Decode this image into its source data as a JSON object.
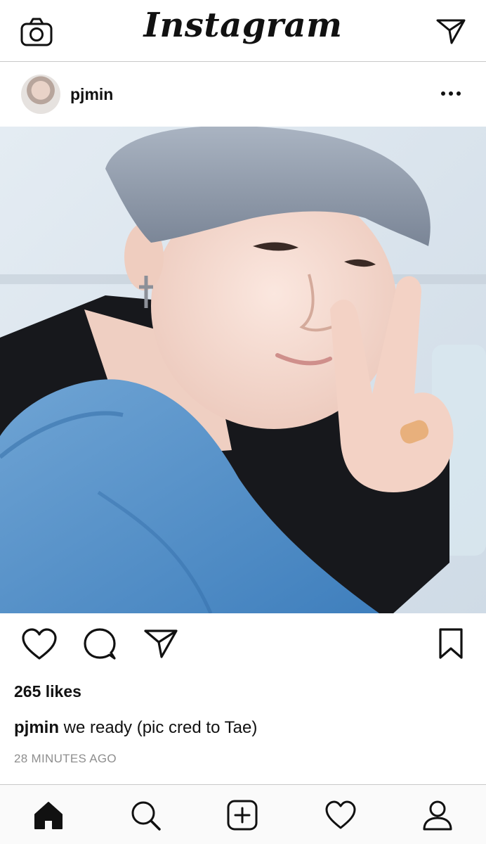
{
  "app": {
    "title": "Instagram"
  },
  "header": {
    "logo_text": "Instagram",
    "camera_icon": "camera-icon",
    "direct_icon": "paper-plane-icon"
  },
  "post": {
    "username": "pjmin",
    "more_icon": "ellipsis-icon",
    "photo_subject": "photo",
    "likes_text": "265 likes",
    "caption_user": "pjmin",
    "caption_text": " we ready (pic cred to Tae)",
    "timestamp": "28 MINUTES AGO"
  },
  "actions": {
    "like_icon": "heart-icon",
    "comment_icon": "comment-icon",
    "share_icon": "paper-plane-icon",
    "save_icon": "bookmark-icon"
  },
  "bottom_nav": {
    "items": [
      "home-icon",
      "search-icon",
      "add-post-icon",
      "activity-heart-icon",
      "profile-icon"
    ]
  },
  "colors": {
    "text": "#111111",
    "muted": "#8e8e8e",
    "divider": "#c9c9c9",
    "nav_bg": "#fafafa"
  }
}
